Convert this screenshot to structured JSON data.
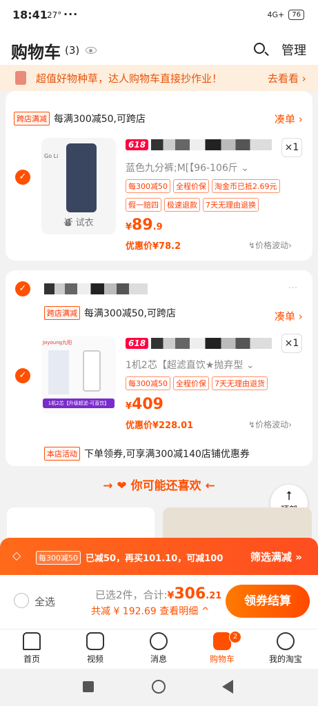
{
  "status": {
    "time": "18:41",
    "temp": "27°",
    "dots": "···",
    "signal": "4G+",
    "battery": "76"
  },
  "header": {
    "title": "购物车",
    "count": "(3)",
    "manage": "管理"
  },
  "banner": {
    "text": "超值好物种草，达人购物车直接抄作业！",
    "go": "去看看"
  },
  "shop1": {
    "tag": "跨店满减",
    "promo": "每满300减50,可跨店",
    "coudan": "凑单"
  },
  "item1": {
    "badge": "618",
    "spec": "蓝色九分裤;M[【96-106斤",
    "chips": [
      "每300减50",
      "全程价保",
      "淘金币已抵2.69元",
      "假一赔四",
      "极速退款",
      "7天无理由退换"
    ],
    "qty": "×1",
    "price_int": "89",
    "price_dec": ".9",
    "currency": "¥",
    "after": "优惠价¥78.2",
    "wave": "价格波动",
    "tryon": "试衣",
    "brand": "Go Li"
  },
  "shop2": {
    "tag": "跨店满减",
    "promo": "每满300减50,可跨店",
    "coudan": "凑单"
  },
  "item2": {
    "badge": "618",
    "spec": "1机2芯【超滤直饮★抛弃型",
    "chips": [
      "每300减50",
      "全程价保",
      "7天无理由退货"
    ],
    "qty": "×1",
    "price": "409",
    "currency": "¥",
    "after": "优惠价¥228.01",
    "wave": "价格波动",
    "brand": "Joyoung九阳",
    "label": "1机2芯【升级超滤-可直饮】"
  },
  "shop2_activity": {
    "tag": "本店活动",
    "text": "下单领券,可享满300减140店铺优惠券"
  },
  "recommend": {
    "title": "你可能还喜欢",
    "backtop": "顶部"
  },
  "discount": {
    "tag": "每300减50",
    "text": "已减50，再买101.10，可减100",
    "filter": "筛选满减"
  },
  "settle": {
    "selectall": "全选",
    "selected": "已选2件，合计:",
    "currency": "¥",
    "total_int": "306",
    "total_dec": ".21",
    "saved": "共减 ¥ 192.69",
    "detail": "查看明细",
    "button": "领券结算"
  },
  "tabs": [
    {
      "label": "首页"
    },
    {
      "label": "视频"
    },
    {
      "label": "消息"
    },
    {
      "label": "购物车",
      "badge": "2"
    },
    {
      "label": "我的淘宝"
    }
  ],
  "colors": {
    "accent": "#ff5000"
  }
}
